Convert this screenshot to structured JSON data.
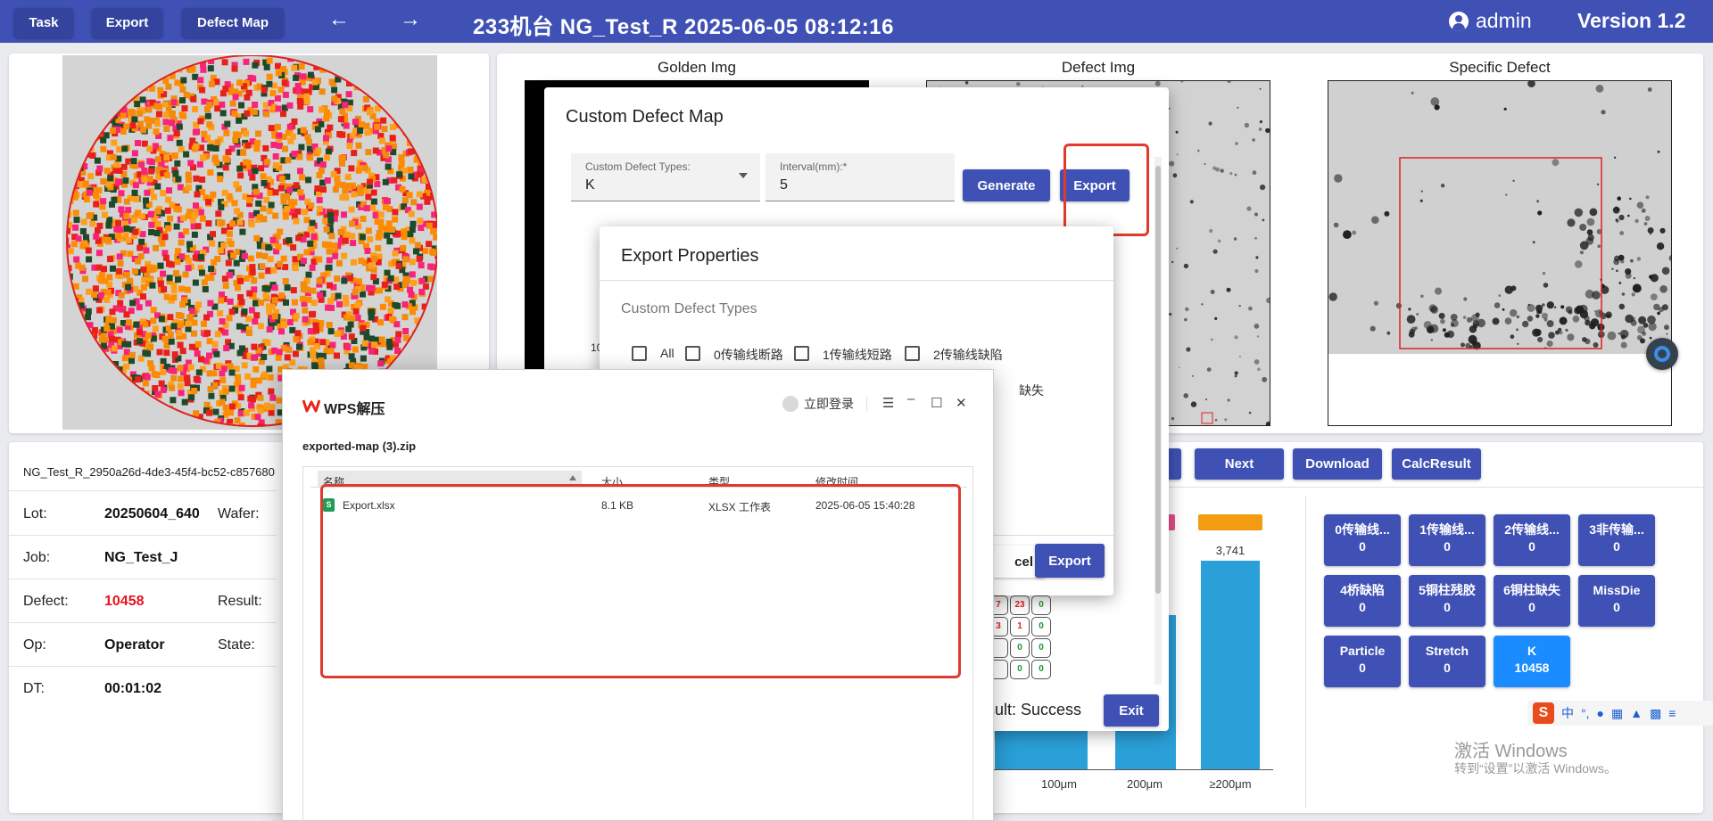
{
  "topbar": {
    "task": "Task",
    "export": "Export",
    "defect_map": "Defect Map",
    "back_arrow": "←",
    "forward_arrow": "→",
    "title": "233机台   NG_Test_R   2025-06-05 08:12:16",
    "user": "admin",
    "version": "Version 1.2"
  },
  "images": {
    "golden": "Golden Img",
    "defect": "Defect Img",
    "specific": "Specific Defect"
  },
  "info": {
    "id": "NG_Test_R_2950a26d-4de3-45f4-bc52-c857680",
    "lot_label": "Lot:",
    "lot": "20250604_640",
    "wafer_label": "Wafer:",
    "job_label": "Job:",
    "job": "NG_Test_J",
    "defect_label": "Defect:",
    "defect": "10458",
    "result_label": "Result:",
    "op_label": "Op:",
    "op": "Operator",
    "state_label": "State:",
    "dt_label": "DT:",
    "dt": "00:01:02"
  },
  "nav": {
    "prev_partial": "s",
    "next": "Next",
    "download": "Download",
    "calc": "CalcResult"
  },
  "defect_types": [
    {
      "name": "0传输线...",
      "count": "0"
    },
    {
      "name": "1传输线...",
      "count": "0"
    },
    {
      "name": "2传输线...",
      "count": "0"
    },
    {
      "name": "3非传输...",
      "count": "0"
    },
    {
      "name": "4桥缺陷",
      "count": "0"
    },
    {
      "name": "5铜柱残胶",
      "count": "0"
    },
    {
      "name": "6铜柱缺失",
      "count": "0"
    },
    {
      "name": "MissDie",
      "count": "0"
    },
    {
      "name": "Particle",
      "count": "0"
    },
    {
      "name": "Stretch",
      "count": "0"
    },
    {
      "name": "K",
      "count": "10458"
    }
  ],
  "chart_data": {
    "type": "bar",
    "categories": [
      "100μm",
      "200μm",
      "≥200μm"
    ],
    "data_labels": [
      "3,741"
    ],
    "colors": {
      "bar": "#2a9fd8",
      "legend_pink": "#e84b8a",
      "legend_orange": "#f39c12"
    }
  },
  "custom_defect_map": {
    "title": "Custom Defect Map",
    "type_label": "Custom Defect Types:",
    "type_value": "K",
    "interval_label": "Interval(mm):*",
    "interval_value": "5",
    "generate": "Generate",
    "export": "Export",
    "result": "sult: Success",
    "exit": "Exit",
    "left_label": "10",
    "grid_cells": [
      "7",
      "23",
      "0",
      "3",
      "1",
      "0",
      "",
      "0",
      "0",
      "",
      "0",
      "0"
    ]
  },
  "export_properties": {
    "title": "Export Properties",
    "subtitle": "Custom Defect Types",
    "options": [
      "All",
      "0传输线断路",
      "1传输线短路",
      "2传输线缺陷"
    ],
    "partial_option": "缺失",
    "cancel": "cel",
    "export": "Export"
  },
  "wps": {
    "title": "WPS解压",
    "login": "立即登录",
    "archive": "exported-map (3).zip",
    "columns": [
      "名称",
      "大小",
      "类型",
      "修改时间"
    ],
    "row": {
      "name": "Export.xlsx",
      "size": "8.1 KB",
      "type": "XLSX 工作表",
      "modified": "2025-06-05 15:40:28"
    }
  },
  "windows": {
    "activate": "激活 Windows",
    "hint": "转到“设置”以激活 Windows。",
    "ime": "中"
  }
}
